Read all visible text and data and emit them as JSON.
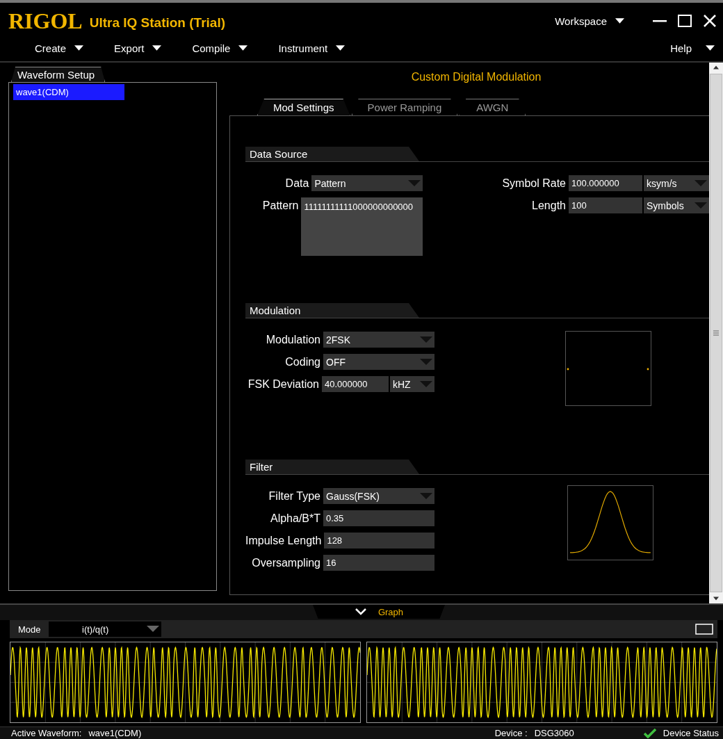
{
  "window": {
    "logo": "RIGOL",
    "title": "Ultra IQ Station (Trial)",
    "workspace": "Workspace"
  },
  "menu": [
    {
      "label": "Create"
    },
    {
      "label": "Export"
    },
    {
      "label": "Compile"
    },
    {
      "label": "Instrument"
    }
  ],
  "help": "Help",
  "sidebar": {
    "tab": "Waveform Setup",
    "items": [
      {
        "label": "wave1(CDM)",
        "selected": true
      }
    ]
  },
  "panel": {
    "title": "Custom Digital Modulation",
    "tabs": [
      {
        "label": "Mod Settings",
        "selected": true
      },
      {
        "label": "Power Ramping",
        "selected": false
      },
      {
        "label": "AWGN",
        "selected": false
      }
    ],
    "sections": [
      {
        "title": "Data Source",
        "kind": "plain",
        "fields": [
          {
            "label": "Data",
            "kind": "select",
            "value": "Pattern"
          },
          {
            "label": "Pattern",
            "kind": "textarea",
            "value": "11111111111000000000000"
          }
        ],
        "right_fields": [
          {
            "label": "Symbol Rate",
            "kind": "input_unit",
            "value": "100.000000",
            "unit": "ksym/s"
          },
          {
            "label": "Length",
            "kind": "input_unit",
            "value": "100",
            "unit": "Symbols"
          }
        ]
      },
      {
        "title": "Modulation",
        "kind": "constellation",
        "fields": [
          {
            "label": "Modulation",
            "kind": "select",
            "value": "2FSK"
          },
          {
            "label": "Coding",
            "kind": "select",
            "value": "OFF"
          },
          {
            "label": "FSK Deviation",
            "kind": "input_unit",
            "value": "40.000000",
            "unit": "kHZ"
          }
        ]
      },
      {
        "title": "Filter",
        "kind": "filter_response",
        "fields": [
          {
            "label": "Filter Type",
            "kind": "select",
            "value": "Gauss(FSK)"
          },
          {
            "label": "Alpha/B*T",
            "kind": "input",
            "value": "0.35"
          },
          {
            "label": "Impulse Length",
            "kind": "input",
            "value": "128"
          },
          {
            "label": "Oversampling",
            "kind": "input",
            "value": "16"
          }
        ]
      }
    ]
  },
  "graph": {
    "label": "Graph",
    "mode_label": "Mode",
    "mode": "i(t)/q(t)"
  },
  "status_bar": {
    "active_label": "Active Waveform:",
    "active": "wave1(CDM)",
    "device_label": "Device :",
    "device": "DSG3060",
    "status": "Device Status"
  }
}
